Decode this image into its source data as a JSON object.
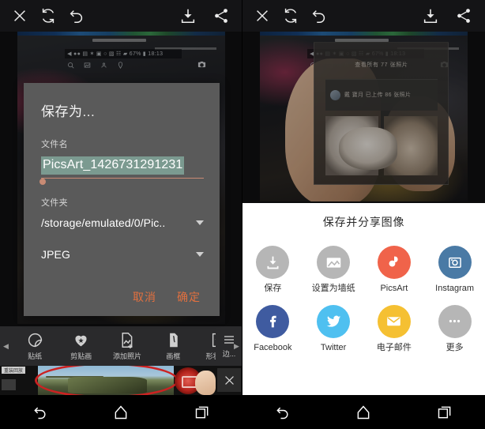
{
  "toolbar": {
    "close_label": "close-icon",
    "redo_label": "refresh-icon",
    "undo_label": "undo-icon",
    "download_label": "download-icon",
    "share_label": "share-icon"
  },
  "photo_overlay": {
    "status_icons": "◀ ●● ▤   ✶ ▣ ○ ▧ ☷  ▰ 67%  ▮  18:13",
    "screen_top_text": "查看所有 77 张照片",
    "screen_card_text": "戴 寶月 已上传 86 张照片"
  },
  "save_dialog": {
    "title": "保存为...",
    "filename_label": "文件名",
    "filename_value": "PicsArt_1426731291231",
    "folder_label": "文件夹",
    "folder_value": "/storage/emulated/0/Pic..",
    "format_value": "JPEG",
    "cancel_label": "取消",
    "confirm_label": "确定",
    "accent_color": "#e2703f",
    "background_color": "#5a5a5a",
    "selection_color": "#7b9a90"
  },
  "tool_strip": {
    "prev_arrow": "◀",
    "next_arrow": "▶",
    "items": [
      {
        "label": "贴纸",
        "icon": "sticker-icon"
      },
      {
        "label": "剪贴画",
        "icon": "clipart-heart-icon"
      },
      {
        "label": "添加照片",
        "icon": "add-photo-icon"
      },
      {
        "label": "画框",
        "icon": "frame-icon"
      },
      {
        "label": "形状遮...",
        "icon": "shape-mask-star-icon"
      }
    ],
    "edge_label": "边..."
  },
  "filmstrip": {
    "tag_label": "重装回放",
    "close_label": "close-icon"
  },
  "share_sheet": {
    "title": "保存并分享图像",
    "rows": [
      [
        {
          "label": "保存",
          "icon": "download-icon",
          "color": "#b6b6b6"
        },
        {
          "label": "设置为墙纸",
          "icon": "wallpaper-icon",
          "color": "#b6b6b6"
        },
        {
          "label": "PicsArt",
          "icon": "picsart-icon",
          "color": "#f0634a"
        },
        {
          "label": "Instagram",
          "icon": "instagram-icon",
          "color": "#4a7aa5"
        }
      ],
      [
        {
          "label": "Facebook",
          "icon": "facebook-icon",
          "color": "#3f5ba0"
        },
        {
          "label": "Twitter",
          "icon": "twitter-icon",
          "color": "#4fc0f0"
        },
        {
          "label": "电子邮件",
          "icon": "email-icon",
          "color": "#f5c032"
        },
        {
          "label": "更多",
          "icon": "more-dots-icon",
          "color": "#b6b6b6"
        }
      ]
    ]
  },
  "navbar": {
    "back_label": "back-icon",
    "home_label": "home-icon",
    "recents_label": "recents-icon"
  }
}
